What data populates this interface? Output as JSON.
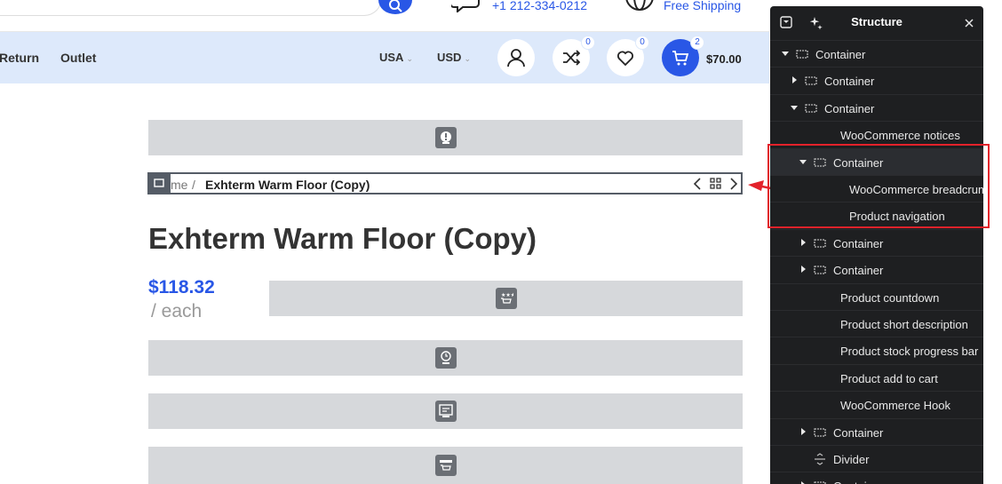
{
  "top_bar": {
    "phone": "+1 212-334-0212",
    "shipping": "Free Shipping"
  },
  "nav": {
    "links": [
      "Return",
      "Outlet"
    ],
    "country": "USA",
    "currency": "USD",
    "compare_count": "0",
    "wishlist_count": "0",
    "cart_count": "2",
    "cart_total": "$70.00"
  },
  "breadcrumb": {
    "home": "me",
    "separator": "/",
    "current": "Exhterm Warm Floor (Copy)"
  },
  "product": {
    "title": "Exhterm Warm Floor (Copy)",
    "price": "$118.32",
    "unit": "/ each"
  },
  "panel": {
    "title": "Structure",
    "rows": [
      {
        "label": "Container",
        "depth": 0,
        "caret": "down",
        "icon": "container"
      },
      {
        "label": "Container",
        "depth": 1,
        "caret": "right",
        "icon": "container"
      },
      {
        "label": "Container",
        "depth": 1,
        "caret": "down",
        "icon": "container"
      },
      {
        "label": "WooCommerce notices",
        "depth": 2,
        "caret": "none",
        "icon": "none"
      },
      {
        "label": "Container",
        "depth": 2,
        "caret": "down",
        "icon": "container",
        "selected": true
      },
      {
        "label": "WooCommerce breadcrumbs",
        "depth": 3,
        "caret": "none",
        "icon": "none"
      },
      {
        "label": "Product navigation",
        "depth": 3,
        "caret": "none",
        "icon": "none"
      },
      {
        "label": "Container",
        "depth": 2,
        "caret": "right",
        "icon": "container"
      },
      {
        "label": "Container",
        "depth": 2,
        "caret": "right",
        "icon": "container"
      },
      {
        "label": "Product countdown",
        "depth": 2,
        "caret": "none",
        "icon": "none"
      },
      {
        "label": "Product short description",
        "depth": 2,
        "caret": "none",
        "icon": "none"
      },
      {
        "label": "Product stock progress bar",
        "depth": 2,
        "caret": "none",
        "icon": "none"
      },
      {
        "label": "Product add to cart",
        "depth": 2,
        "caret": "none",
        "icon": "none"
      },
      {
        "label": "WooCommerce Hook",
        "depth": 2,
        "caret": "none",
        "icon": "none"
      },
      {
        "label": "Container",
        "depth": 2,
        "caret": "right",
        "icon": "container"
      },
      {
        "label": "Divider",
        "depth": 2,
        "caret": "none",
        "icon": "divider"
      },
      {
        "label": "Container",
        "depth": 2,
        "caret": "right",
        "icon": "container"
      }
    ]
  },
  "colors": {
    "accent": "#2957e6",
    "nav_bg": "#dde9fb",
    "panel_bg": "#1e1f21",
    "highlight": "#e3222b",
    "placeholder": "#d6d8db"
  }
}
